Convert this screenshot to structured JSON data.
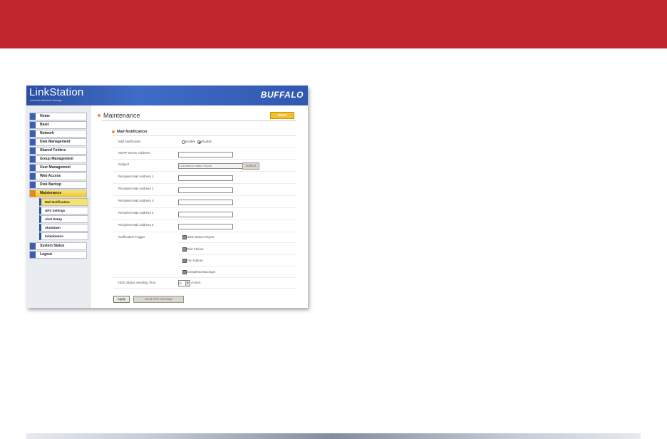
{
  "colors": {
    "banner": "#c0272d",
    "header_blue": "#2b4fa2",
    "active_nav": "#f2c531",
    "help": "#f3c12c"
  },
  "app": {
    "logo": "LinkStation",
    "tagline": "network attached storage",
    "brand": "BUFFALO"
  },
  "sidebar": {
    "items": [
      {
        "label": "Home",
        "icon": "home-icon"
      },
      {
        "label": "Basic",
        "icon": "basic-icon"
      },
      {
        "label": "Network",
        "icon": "network-icon"
      },
      {
        "label": "Disk Management",
        "icon": "disk-icon"
      },
      {
        "label": "Shared Folders",
        "icon": "folder-icon"
      },
      {
        "label": "Group Management",
        "icon": "group-icon"
      },
      {
        "label": "User Management",
        "icon": "user-icon"
      },
      {
        "label": "Web Access",
        "icon": "web-icon"
      },
      {
        "label": "Disk Backup",
        "icon": "backup-icon"
      },
      {
        "label": "Maintenance",
        "icon": "tools-icon",
        "active": true
      },
      {
        "label": "System Status",
        "icon": "status-icon"
      },
      {
        "label": "Logout",
        "icon": "logout-icon"
      }
    ],
    "sub_items": [
      {
        "label": "Mail Notification",
        "active": true
      },
      {
        "label": "UPS Settings"
      },
      {
        "label": "Alert Setup"
      },
      {
        "label": "Shutdown"
      },
      {
        "label": "Initialization"
      }
    ]
  },
  "main": {
    "title": "Maintenance",
    "help_label": "HELP",
    "section_title": "Mail Notification",
    "fields": {
      "mail_notification": {
        "label": "Mail Notification",
        "enable": "Enable",
        "disable": "Disable",
        "selected": "Disable"
      },
      "smtp": {
        "label": "SMTP Server Address",
        "value": ""
      },
      "subject": {
        "label": "Subject",
        "value": "LinkStation Status Report",
        "default_button": "Default"
      },
      "recipients": [
        {
          "label": "Recipient Mail Address 1",
          "value": ""
        },
        {
          "label": "Recipient Mail Address 2",
          "value": ""
        },
        {
          "label": "Recipient Mail Address 3",
          "value": ""
        },
        {
          "label": "Recipient Mail Address 4",
          "value": ""
        },
        {
          "label": "Recipient Mail Address 5",
          "value": ""
        }
      ],
      "trigger": {
        "label": "Notification Trigger",
        "options": [
          {
            "label": "HDD Status Report",
            "checked": true
          },
          {
            "label": "Disk Failure",
            "checked": true
          },
          {
            "label": "Fan Failure",
            "checked": true
          },
          {
            "label": "Completed Backups",
            "checked": true
          }
        ]
      },
      "send_time": {
        "label": "HDD Status Sending Time",
        "value": "0",
        "suffix": "o'clock"
      }
    },
    "buttons": {
      "apply": "Apply",
      "test": "Send Test Message"
    }
  }
}
